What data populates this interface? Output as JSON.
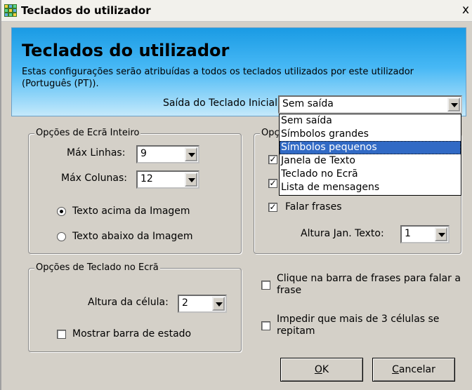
{
  "window": {
    "title": "Teclados do utilizador",
    "close": "x"
  },
  "header": {
    "title": "Teclados do utilizador",
    "description": "Estas configurações serão atribuídas a todos os teclados utilizados por este utilizador (Português (PT)).",
    "output_label": "Saída do Teclado Inicial:",
    "output_value": "Sem saída"
  },
  "output_options": [
    "Sem saída",
    "Símbolos grandes",
    "Símbolos pequenos",
    "Janela de Texto",
    "Teclado no Ecrã",
    "Lista de mensagens"
  ],
  "fullscreen": {
    "legend": "Opções de Ecrã Inteiro",
    "max_rows_label": "Máx Linhas:",
    "max_rows_value": "9",
    "max_cols_label": "Máx Colunas:",
    "max_cols_value": "12",
    "radio_above": "Texto acima da Imagem",
    "radio_below": "Texto abaixo da Imagem",
    "selected_radio": "above"
  },
  "text_window": {
    "legend_partial": "Opç",
    "speak_phrases": "Falar frases",
    "speak_checked": true,
    "checkbox1_checked": true,
    "checkbox2_checked": true,
    "height_label": "Altura Jan. Texto:",
    "height_value": "1"
  },
  "onscreen": {
    "legend": "Opções de Teclado no Ecrã",
    "cell_height_label": "Altura da célula:",
    "cell_height_value": "2",
    "status_bar": "Mostrar barra de estado",
    "status_bar_checked": false
  },
  "options": {
    "click_phrase_bar": "Clique na barra de frases para falar a frase",
    "prevent_repeat": "Impedir que mais de 3 células se repitam"
  },
  "buttons": {
    "ok_mnemonic": "O",
    "ok_rest": "K",
    "cancel_mnemonic": "C",
    "cancel_rest": "ancelar"
  },
  "colors": {
    "header_top": "#1a9be4",
    "header_bottom": "#c4e9fb",
    "selection": "#316ac5",
    "dialog_bg": "#d4d0c8"
  }
}
